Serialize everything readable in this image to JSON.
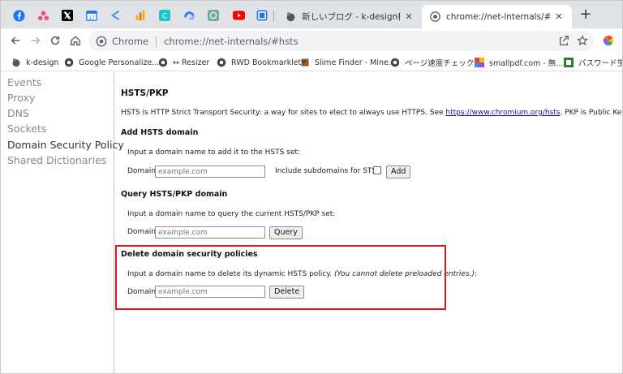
{
  "tabs": {
    "pinned": [
      "facebook-icon",
      "asana-icon",
      "x-icon",
      "calendar-icon",
      "inbox-icon",
      "analytics-icon",
      "canva-icon",
      "swirl-icon",
      "chatgpt-icon",
      "youtube-icon",
      "window-icon"
    ],
    "tab1_title": "新しいブログ - k-design株式会社 -",
    "tab2_title": "chrome://net-internals/#hsts",
    "new_tab": "+"
  },
  "toolbar": {
    "chip_label": "Chrome",
    "url": "chrome://net-internals/#hsts"
  },
  "bookmarks": [
    "k-design",
    "Google Personalize...",
    "↔ Resizer",
    "RWD Bookmarklet",
    "Slime Finder - Mine...",
    "ページ速度チェック",
    "smallpdf.com - 無...",
    "パスワード生成"
  ],
  "sidebar": {
    "items": [
      "Events",
      "Proxy",
      "DNS",
      "Sockets",
      "Domain Security Policy",
      "Shared Dictionaries"
    ]
  },
  "hsts": {
    "title": "HSTS/PKP",
    "intro_before": "HSTS is HTTP Strict Transport Security: a way for sites to elect to always use HTTPS. See ",
    "intro_link": "https://www.chromium.org/hsts",
    "intro_after": ". PKP is Public Key Pinning: Chrom",
    "add": {
      "heading": "Add HSTS domain",
      "desc": "Input a domain name to add it to the HSTS set:",
      "label": "Domain:",
      "placeholder": "example.com",
      "subdomains_label": "Include subdomains for STS:",
      "button": "Add"
    },
    "query": {
      "heading": "Query HSTS/PKP domain",
      "desc": "Input a domain name to query the current HSTS/PKP set:",
      "label": "Domain:",
      "placeholder": "example.com",
      "button": "Query"
    },
    "delete": {
      "heading": "Delete domain security policies",
      "desc": "Input a domain name to delete its dynamic HSTS policy. ",
      "desc_italic": "(You cannot delete preloaded entries.)",
      "desc_end": ":",
      "label": "Domain:",
      "placeholder": "example.com",
      "button": "Delete"
    }
  },
  "colors": {
    "highlight": "#d9181f",
    "link": "#1a0dab"
  }
}
